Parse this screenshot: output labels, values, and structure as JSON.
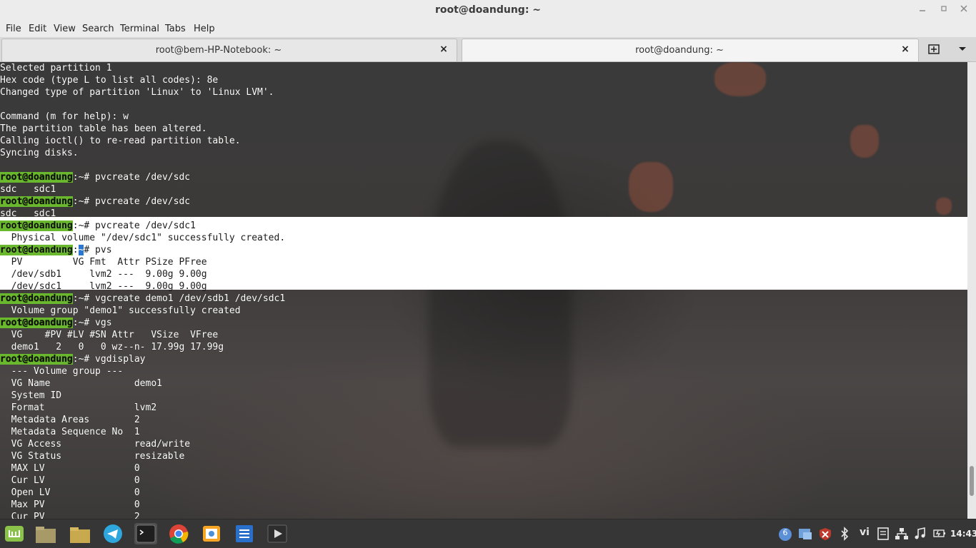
{
  "window": {
    "title": "root@doandung: ~"
  },
  "menu": {
    "items": [
      "File",
      "Edit",
      "View",
      "Search",
      "Terminal",
      "Tabs",
      "Help"
    ]
  },
  "tabs": [
    {
      "label": "root@bem-HP-Notebook: ~",
      "close": "×"
    },
    {
      "label": "root@doandung: ~",
      "close": "×"
    }
  ],
  "terminal": {
    "prompt_user": "root@doandung",
    "prompt_suffix": ":~#",
    "lines": [
      {
        "kind": "out",
        "text": "Selected partition 1"
      },
      {
        "kind": "out",
        "text": "Hex code (type L to list all codes): 8e"
      },
      {
        "kind": "out",
        "text": "Changed type of partition 'Linux' to 'Linux LVM'."
      },
      {
        "kind": "out",
        "text": ""
      },
      {
        "kind": "out",
        "text": "Command (m for help): w"
      },
      {
        "kind": "out",
        "text": "The partition table has been altered."
      },
      {
        "kind": "out",
        "text": "Calling ioctl() to re-read partition table."
      },
      {
        "kind": "out",
        "text": "Syncing disks."
      },
      {
        "kind": "out",
        "text": ""
      },
      {
        "kind": "cmd",
        "text": " pvcreate /dev/sdc"
      },
      {
        "kind": "out",
        "text": "sdc   sdc1"
      },
      {
        "kind": "cmd",
        "text": " pvcreate /dev/sdc"
      },
      {
        "kind": "out",
        "text": "sdc   sdc1"
      },
      {
        "kind": "cmd",
        "text": "pvcreate /dev/sdc1"
      },
      {
        "kind": "out",
        "text": "  Physical volume \"/dev/sdc1\" successfully created."
      },
      {
        "kind": "cmd",
        "text": " pvs"
      },
      {
        "kind": "out",
        "text": "  PV         VG Fmt  Attr PSize PFree"
      },
      {
        "kind": "out",
        "text": "  /dev/sdb1     lvm2 ---  9.00g 9.00g"
      },
      {
        "kind": "out",
        "text": "  /dev/sdc1     lvm2 ---  9.00g 9.00g"
      },
      {
        "kind": "cmd",
        "text": " vgcreate demo1 /dev/sdb1 /dev/sdc1"
      },
      {
        "kind": "out",
        "text": "  Volume group \"demo1\" successfully created"
      },
      {
        "kind": "cmd",
        "text": " vgs"
      },
      {
        "kind": "out",
        "text": "  VG    #PV #LV #SN Attr   VSize  VFree"
      },
      {
        "kind": "out",
        "text": "  demo1   2   0   0 wz--n- 17.99g 17.99g"
      },
      {
        "kind": "cmd",
        "text": " vgdisplay"
      },
      {
        "kind": "out",
        "text": "  --- Volume group ---"
      },
      {
        "kind": "out",
        "text": "  VG Name               demo1"
      },
      {
        "kind": "out",
        "text": "  System ID"
      },
      {
        "kind": "out",
        "text": "  Format                lvm2"
      },
      {
        "kind": "out",
        "text": "  Metadata Areas        2"
      },
      {
        "kind": "out",
        "text": "  Metadata Sequence No  1"
      },
      {
        "kind": "out",
        "text": "  VG Access             read/write"
      },
      {
        "kind": "out",
        "text": "  VG Status             resizable"
      },
      {
        "kind": "out",
        "text": "  MAX LV                0"
      },
      {
        "kind": "out",
        "text": "  Cur LV                0"
      },
      {
        "kind": "out",
        "text": "  Open LV               0"
      },
      {
        "kind": "out",
        "text": "  Max PV                0"
      },
      {
        "kind": "out",
        "text": "  Cur PV                2"
      }
    ]
  },
  "taskbar": {
    "apps": [
      "mint-menu-icon",
      "files-icon",
      "folder-icon",
      "telegram-icon",
      "terminal-icon",
      "chrome-icon",
      "image-viewer-icon",
      "document-icon",
      "media-player-icon"
    ],
    "tray": {
      "notification_count": "6",
      "keyboard_layout": "vi",
      "clock": "14:43"
    }
  },
  "colors": {
    "prompt_bg": "#6ab82d",
    "selection_bg": "#ffffff",
    "cursor": "#2a76d2",
    "taskbar": "#363636"
  }
}
